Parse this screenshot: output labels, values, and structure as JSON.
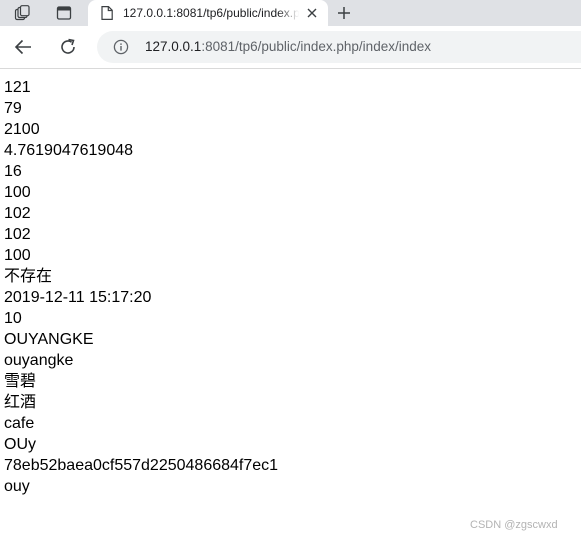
{
  "browser": {
    "tab": {
      "title": "127.0.0.1:8081/tp6/public/index.php/index/index"
    },
    "address_bar": {
      "host": "127.0.0.1",
      "rest": ":8081/tp6/public/index.php/index/index"
    }
  },
  "icons": {
    "workspaces": "workspaces-icon",
    "tab_actions": "tab-actions-icon",
    "favicon": "page-icon",
    "close": "close-icon",
    "new_tab": "plus-icon",
    "back": "back-arrow-icon",
    "reload": "reload-icon",
    "site_info": "info-icon"
  },
  "page": {
    "lines": [
      "121",
      "79",
      "2100",
      "4.7619047619048",
      "16",
      "100",
      "102",
      "102",
      "100",
      "不存在",
      "2019-12-11 15:17:20",
      "10",
      "OUYANGKE",
      "ouyangke",
      "雪碧",
      "红酒",
      "cafe",
      "OUy",
      "78eb52baea0cf557d2250486684f7ec1",
      "ouy"
    ]
  },
  "watermark": "CSDN @zgscwxd"
}
